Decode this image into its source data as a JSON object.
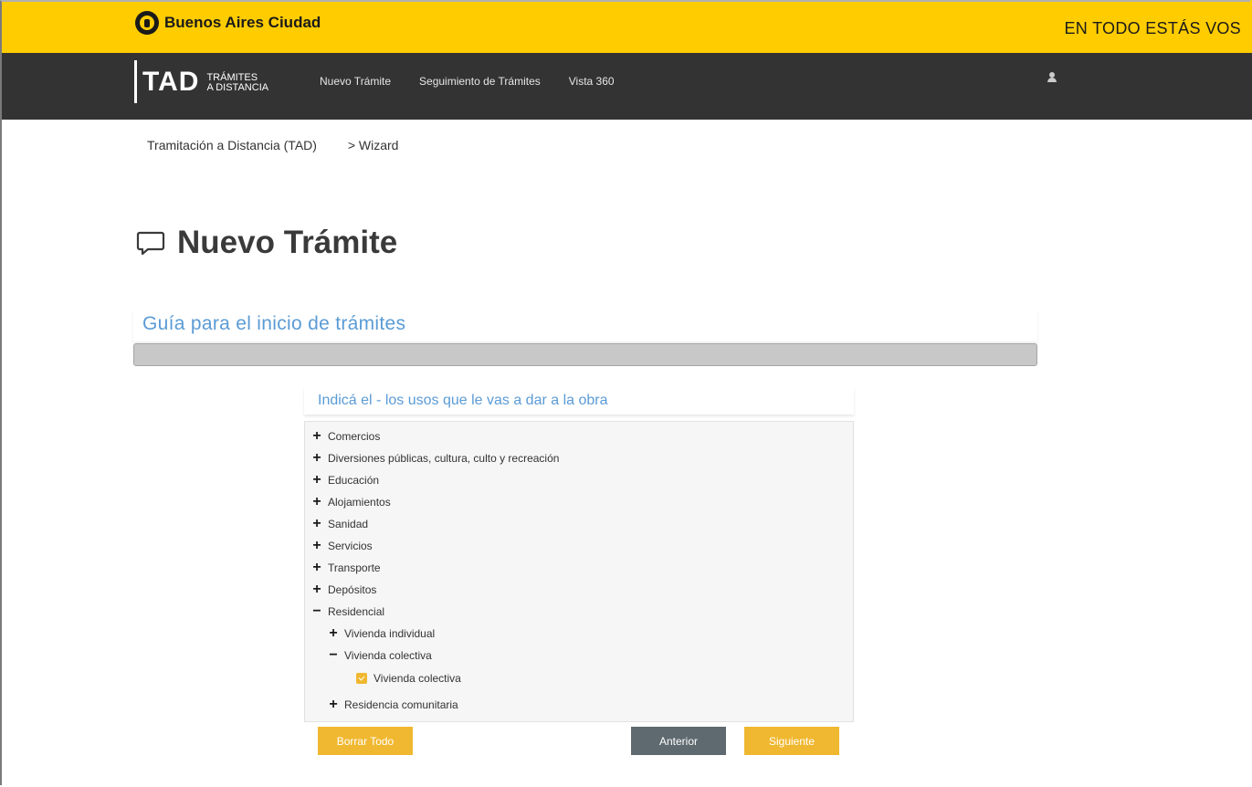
{
  "header": {
    "brand": "Buenos Aires Ciudad",
    "slogan": "EN TODO ESTÁS VOS"
  },
  "nav": {
    "logo_big": "TAD",
    "logo_small_line1": "TRÁMITES",
    "logo_small_line2": "A DISTANCIA",
    "links": [
      "Nuevo Trámite",
      "Seguimiento de Trámites",
      "Vista 360"
    ]
  },
  "breadcrumb": {
    "item1": "Tramitación a Distancia (TAD)",
    "item2": "> Wizard"
  },
  "page": {
    "title": "Nuevo Trámite"
  },
  "guide": {
    "title": "Guía para el inicio de trámites",
    "progress_percent": 0
  },
  "question": {
    "text": "Indicá el - los usos que le vas a dar a la obra"
  },
  "tree": {
    "items": [
      {
        "label": "Comercios",
        "expanded": false
      },
      {
        "label": "Diversiones públicas, cultura, culto y recreación",
        "expanded": false
      },
      {
        "label": "Educación",
        "expanded": false
      },
      {
        "label": "Alojamientos",
        "expanded": false
      },
      {
        "label": "Sanidad",
        "expanded": false
      },
      {
        "label": "Servicios",
        "expanded": false
      },
      {
        "label": "Transporte",
        "expanded": false
      },
      {
        "label": "Depósitos",
        "expanded": false
      },
      {
        "label": "Residencial",
        "expanded": true
      },
      {
        "label": "Vivienda individual",
        "expanded": false
      },
      {
        "label": "Vivienda colectiva",
        "expanded": true
      },
      {
        "label": "Vivienda colectiva",
        "checked": true
      },
      {
        "label": "Residencia comunitaria",
        "expanded": false
      }
    ]
  },
  "buttons": {
    "clear": "Borrar Todo",
    "prev": "Anterior",
    "next": "Siguiente"
  },
  "colors": {
    "header_yellow": "#ffcc00",
    "nav_dark": "#333333",
    "accent_blue": "#5b9bd5",
    "button_yellow": "#f0b830",
    "button_gray": "#5f6a70"
  }
}
